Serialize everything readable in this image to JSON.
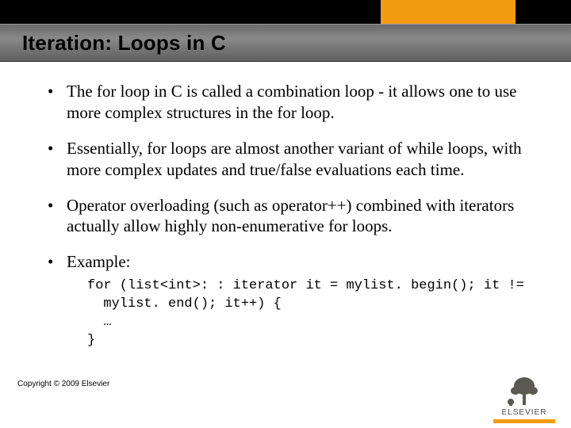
{
  "title": "Iteration: Loops in C",
  "bullets": [
    "The for loop in C is called a combination loop - it allows one to use more complex structures in the for loop.",
    "Essentially, for loops are almost another variant of while loops, with more complex updates and true/false evaluations each time.",
    "Operator overloading (such as operator++) combined with iterators actually allow highly non-enumerative for loops.",
    "Example:"
  ],
  "code": "for (list<int>: : iterator it = mylist. begin(); it !=\n  mylist. end(); it++) {\n  …\n}",
  "copyright": "Copyright © 2009 Elsevier",
  "logo_text": "ELSEVIER"
}
